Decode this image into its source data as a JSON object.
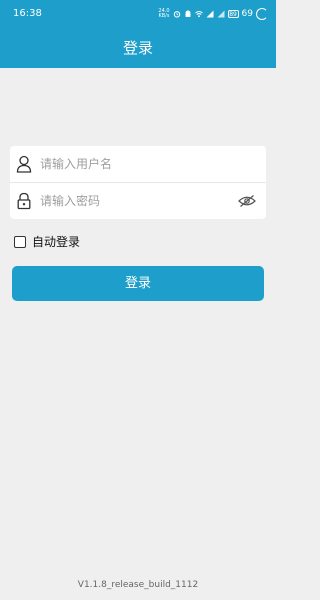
{
  "status_bar": {
    "time": "16:38",
    "net_speed_top": "24.0",
    "net_speed_bottom": "KB/s",
    "battery_label": "69",
    "battery_badge": "89"
  },
  "header": {
    "title": "登录"
  },
  "form": {
    "username_placeholder": "请输入用户名",
    "password_placeholder": "请输入密码"
  },
  "auto_login": {
    "label": "自动登录",
    "checked": false
  },
  "login_button": {
    "label": "登录"
  },
  "footer": {
    "version": "V1.1.8_release_build_1112"
  },
  "colors": {
    "primary": "#1e9fcb",
    "background": "#efefef",
    "card": "#ffffff"
  }
}
